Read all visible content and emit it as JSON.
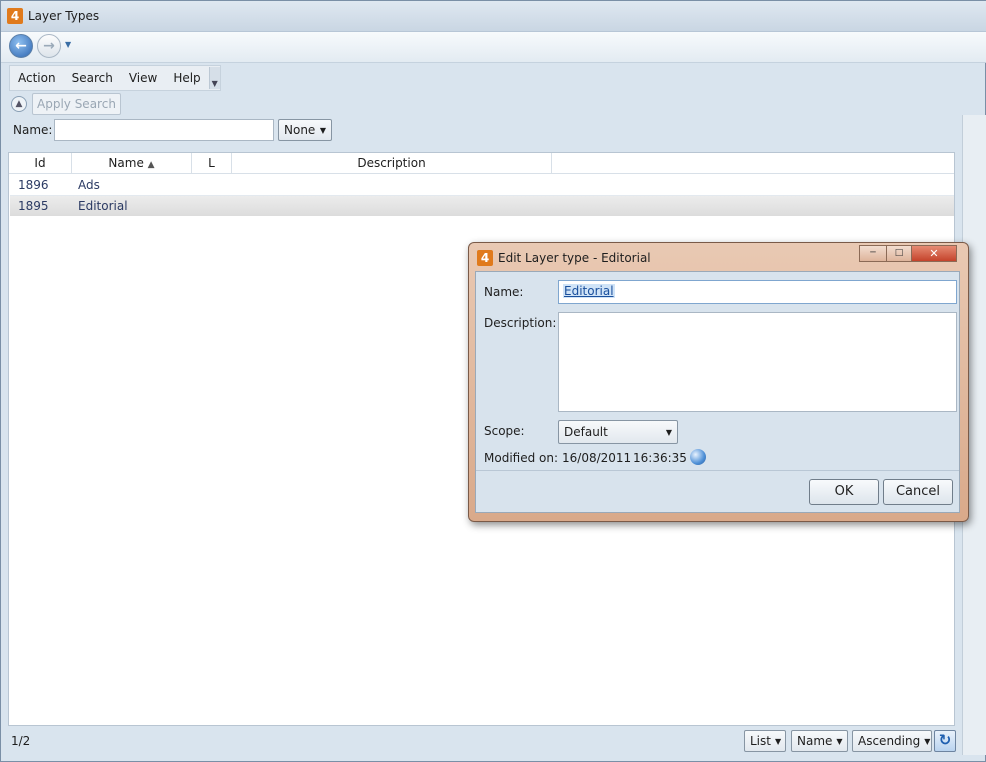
{
  "window": {
    "title": "Layer Types",
    "badge": "4"
  },
  "menu": {
    "items": [
      "Action",
      "Search",
      "View",
      "Help"
    ]
  },
  "search": {
    "apply_label": "Apply Search",
    "name_label": "Name:",
    "name_value": "",
    "mode_value": "None"
  },
  "grid": {
    "columns": [
      "Id",
      "Name",
      "L",
      "Description"
    ],
    "rows": [
      {
        "id": "1896",
        "name": "Ads",
        "l": "",
        "description": ""
      },
      {
        "id": "1895",
        "name": "Editorial",
        "l": "",
        "description": ""
      }
    ]
  },
  "status": {
    "count": "1/2",
    "view_value": "List",
    "sort_field": "Name",
    "sort_order": "Ascending"
  },
  "dialog": {
    "badge": "4",
    "title": "Edit Layer type - Editorial",
    "name_label": "Name:",
    "name_value": "Editorial",
    "description_label": "Description:",
    "description_value": "",
    "scope_label": "Scope:",
    "scope_value": "Default",
    "modified_label": "Modified on:",
    "modified_date": "16/08/2011",
    "modified_time": "16:36:35",
    "ok_label": "OK",
    "cancel_label": "Cancel"
  }
}
